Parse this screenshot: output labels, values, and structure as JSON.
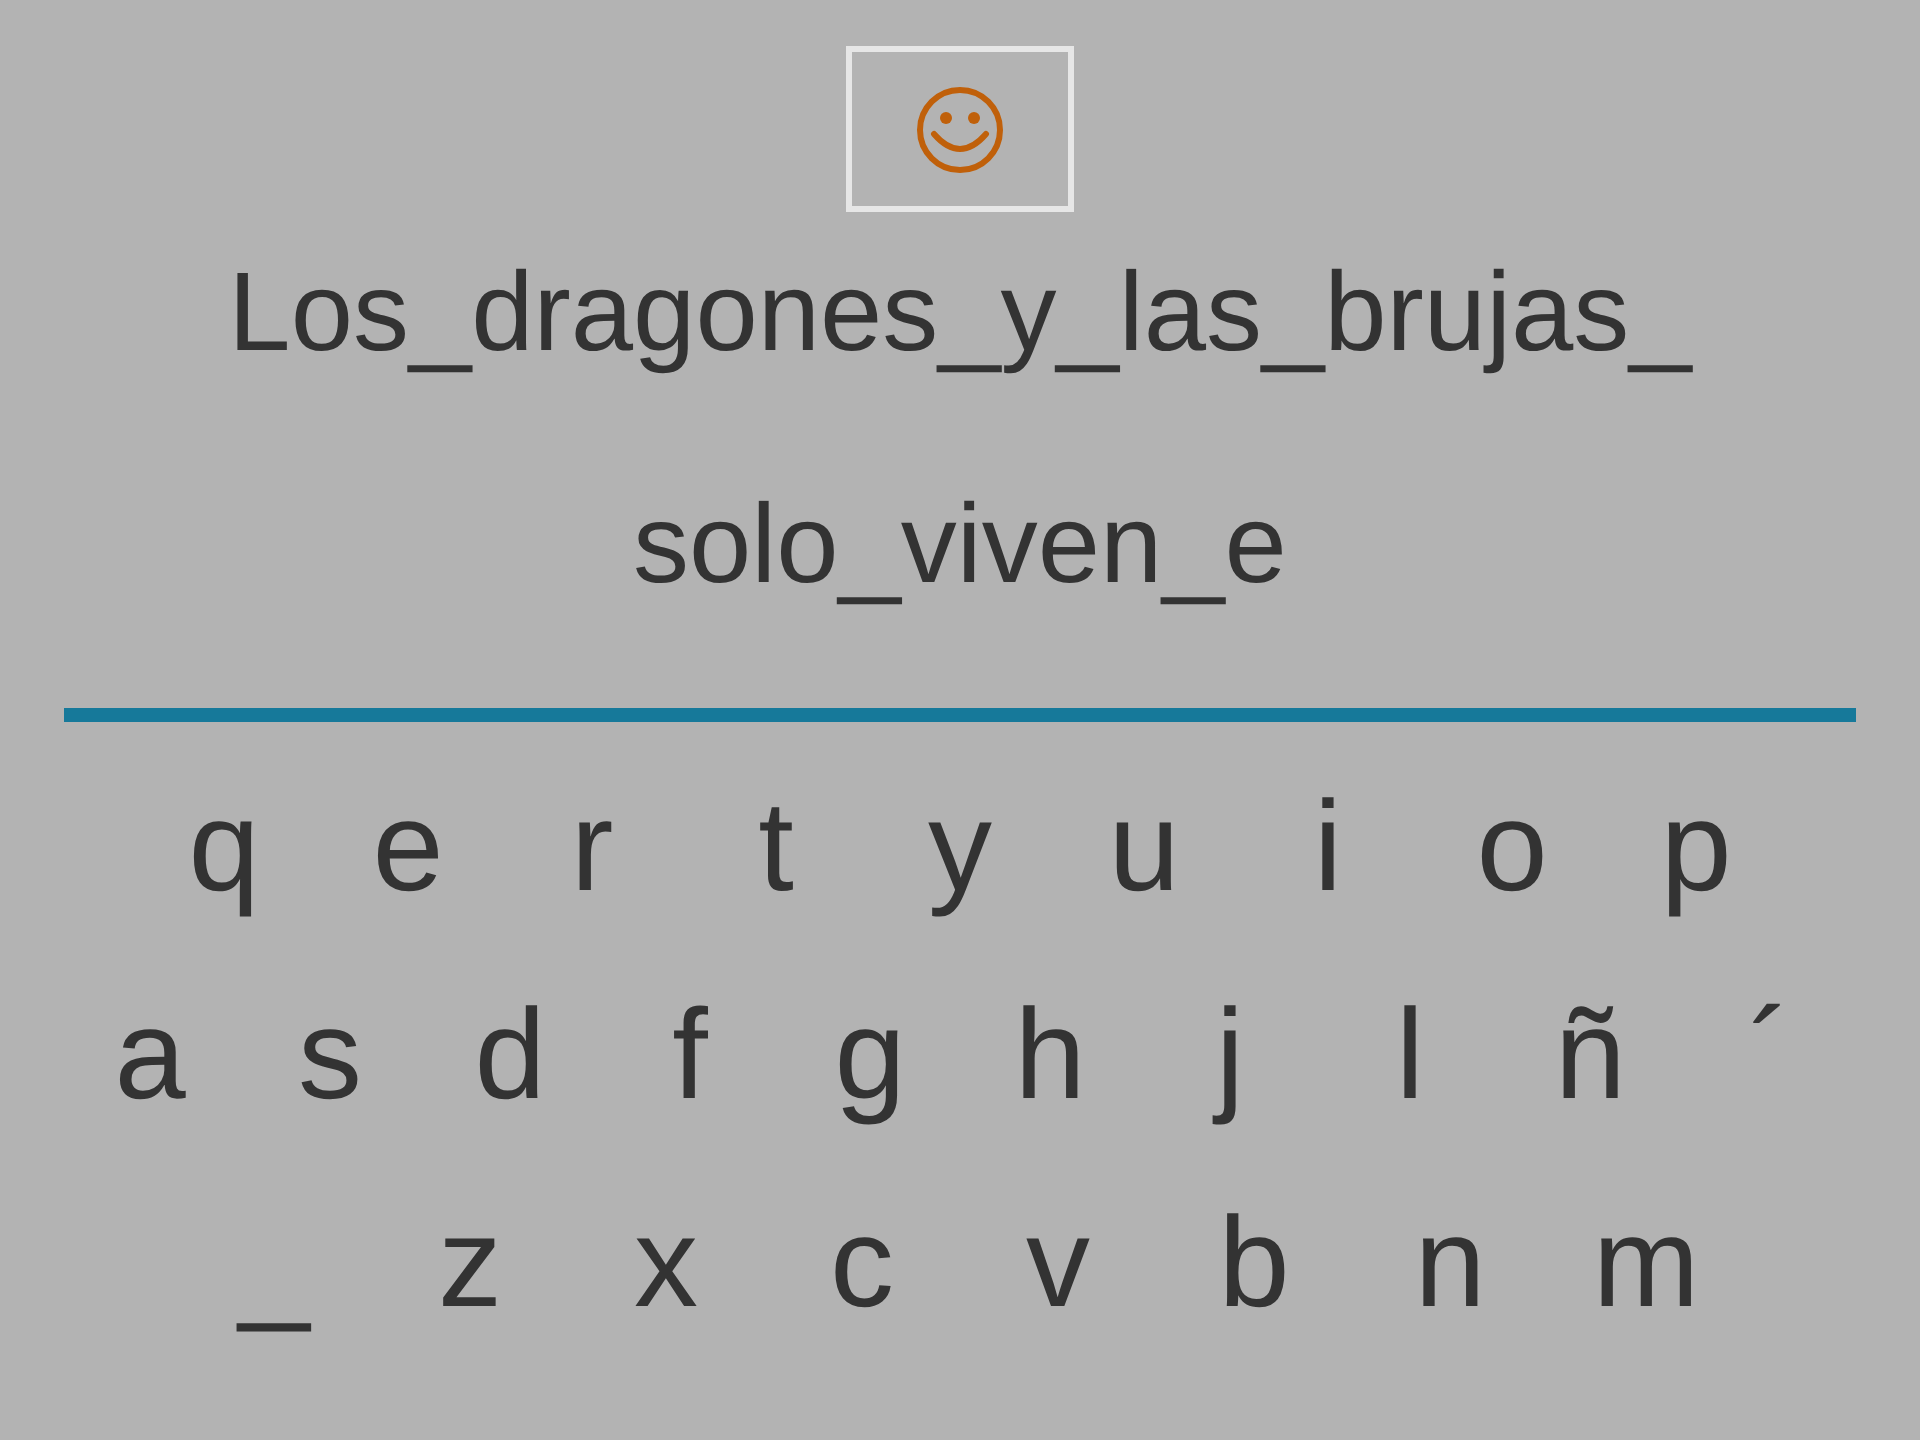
{
  "phrase_lines": [
    "Los_dragones_y_las_brujas_",
    "solo_viven_e"
  ],
  "keyboard_rows": [
    [
      "q",
      "e",
      "r",
      "t",
      "y",
      "u",
      "i",
      "o",
      "p"
    ],
    [
      "a",
      "s",
      "d",
      "f",
      "g",
      "h",
      "j",
      "l",
      "ñ",
      "´"
    ],
    [
      "_",
      "z",
      "x",
      "c",
      "v",
      "b",
      "n",
      "m"
    ]
  ]
}
